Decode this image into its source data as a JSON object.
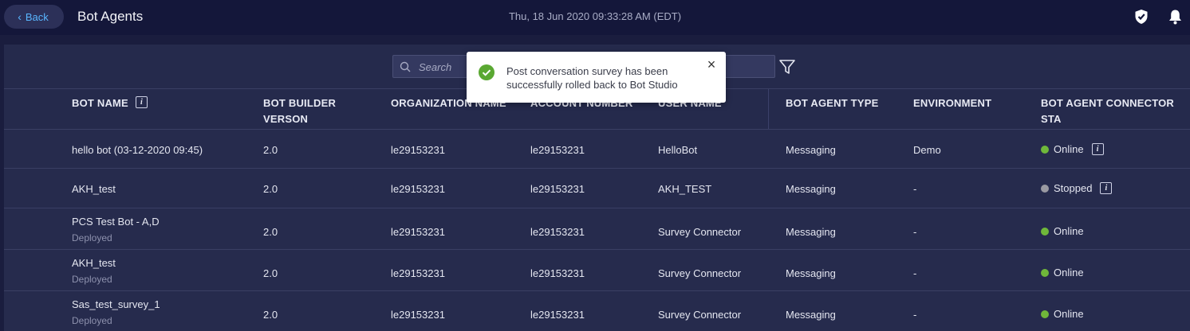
{
  "header": {
    "back_label": "Back",
    "title": "Bot Agents",
    "datetime": "Thu, 18 Jun 2020 09:33:28 AM (EDT)"
  },
  "search": {
    "placeholder": "Search"
  },
  "toast": {
    "message": "Post conversation survey has been successfully rolled back to Bot Studio"
  },
  "table": {
    "headers": {
      "bot_name": "BOT NAME",
      "builder_version_line1": "BOT BUILDER",
      "builder_version_line2": "VERSON",
      "organization": "ORGANIZATION NAME",
      "account": "ACCOUNT NUMBER",
      "user": "USER NAME",
      "agent_type": "BOT AGENT TYPE",
      "environment": "ENVIRONMENT",
      "connector_status": "BOT AGENT CONNECTOR STA"
    },
    "rows": [
      {
        "name": "hello bot (03-12-2020 09:45)",
        "sub": "",
        "version": "2.0",
        "org": "le29153231",
        "account": "le29153231",
        "user": "HelloBot",
        "type": "Messaging",
        "env": "Demo",
        "status": "Online",
        "status_color": "#6fb83a",
        "info": true
      },
      {
        "name": "AKH_test",
        "sub": "",
        "version": "2.0",
        "org": "le29153231",
        "account": "le29153231",
        "user": "AKH_TEST",
        "type": "Messaging",
        "env": "-",
        "status": "Stopped",
        "status_color": "#9a9aa2",
        "info": true
      },
      {
        "name": "PCS Test Bot - A,D",
        "sub": "Deployed",
        "version": "2.0",
        "org": "le29153231",
        "account": "le29153231",
        "user": "Survey Connector",
        "type": "Messaging",
        "env": "-",
        "status": "Online",
        "status_color": "#6fb83a",
        "info": false
      },
      {
        "name": "AKH_test",
        "sub": "Deployed",
        "version": "2.0",
        "org": "le29153231",
        "account": "le29153231",
        "user": "Survey Connector",
        "type": "Messaging",
        "env": "-",
        "status": "Online",
        "status_color": "#6fb83a",
        "info": false
      },
      {
        "name": "Sas_test_survey_1",
        "sub": "Deployed",
        "version": "2.0",
        "org": "le29153231",
        "account": "le29153231",
        "user": "Survey Connector",
        "type": "Messaging",
        "env": "-",
        "status": "Online",
        "status_color": "#6fb83a",
        "info": false
      }
    ]
  },
  "colors": {
    "accent": "#59b6ff",
    "online": "#6fb83a",
    "stopped": "#9a9aa2",
    "success": "#5aa832"
  }
}
